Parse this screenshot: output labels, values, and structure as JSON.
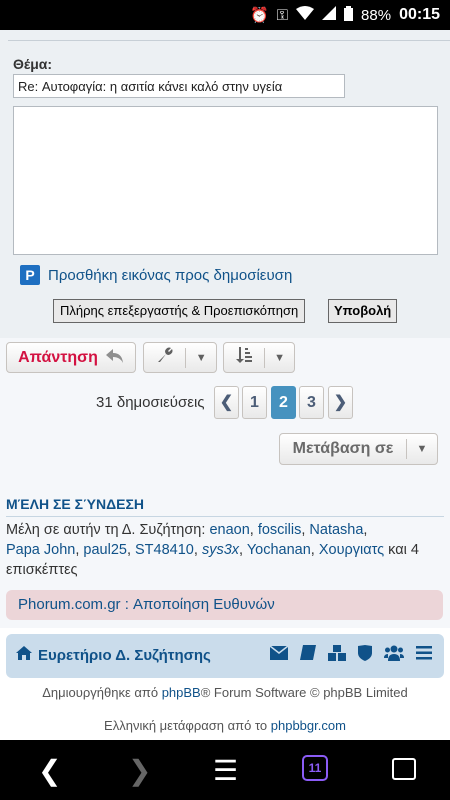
{
  "status_bar": {
    "battery": "88%",
    "time": "00:15"
  },
  "quick_reply": {
    "subject_label": "Θέμα:",
    "subject_value": "Re: Αυτοφαγία: η ασιτία κάνει καλό στην υγεία",
    "message_value": "",
    "postimage_label": "Προσθήκη εικόνας προς δημοσίευση",
    "postimage_icon": "P",
    "full_editor_label": "Πλήρης επεξεργαστής & Προεπισκόπηση",
    "submit_label": "Υποβολή"
  },
  "actions": {
    "reply_label": "Απάντηση"
  },
  "pagination": {
    "post_count": "31 δημοσιεύσεις",
    "pages": [
      "1",
      "2",
      "3"
    ],
    "current": "2"
  },
  "jumpto": {
    "label": "Μετάβαση σε"
  },
  "online": {
    "heading": "ΜΈΛΗ ΣΕ ΣΎΝΔΕΣΗ",
    "prefix": "Μέλη σε αυτήν τη Δ. Συζήτηση: ",
    "users": [
      "enaon",
      "foscilis",
      "Natasha",
      "Papa John",
      "paul25",
      "ST48410",
      "sys3x",
      "Yochanan",
      "Χουργιατς"
    ],
    "suffix": " και 4 επισκέπτες"
  },
  "notice": {
    "text": "Phorum.com.gr : Αποποίηση Ευθυνών"
  },
  "footer": {
    "home_label": "Ευρετήριο Δ. Συζήτησης",
    "copyright_prefix": "Δημιουργήθηκε από ",
    "phpbb_link": "phpBB",
    "copyright_suffix": "® Forum Software © phpBB Limited",
    "translation_prefix": "Ελληνική μετάφραση από το ",
    "translation_link": "phpbbgr.com"
  },
  "browser_nav": {
    "tab_count": "11"
  },
  "colors": {
    "link": "#105289",
    "reply_red": "#d31141",
    "active_page": "#4692bf",
    "notice_bg": "#ecd5d8",
    "footer_bg": "#cadceb"
  }
}
